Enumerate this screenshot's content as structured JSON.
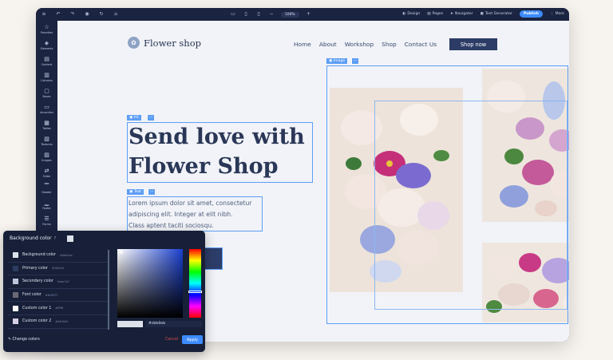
{
  "toolbar": {
    "zoom": "100%",
    "right_items": [
      "Design",
      "Pages",
      "Navigator",
      "Text Generator"
    ],
    "publish": "Publish",
    "more": "More"
  },
  "sidebar": {
    "items": [
      "Favorites",
      "Elements",
      "Content",
      "Columns",
      "Boxes",
      "Accordion",
      "Tables",
      "Textures",
      "Images",
      "Slider",
      "Header",
      "Footer",
      "Forms"
    ]
  },
  "site": {
    "logo_text": "Flower shop",
    "nav": [
      "Home",
      "About",
      "Workshop",
      "Shop",
      "Contact Us"
    ],
    "shop_button": "Shop now",
    "heading_tag": "H1",
    "heading_line1": "Send love with",
    "heading_line2": "Flower Shop",
    "text_tag": "Text",
    "para_line1": "Lorem ipsum dolor sit amet, consectetur",
    "para_line2": "adipiscing elit. Integer at elit nibh.",
    "para_line3": "Class aptent taciti sociosqu.",
    "image_tag": "Image"
  },
  "color_panel": {
    "title": "Background color",
    "colors": [
      {
        "label": "Background color",
        "hex": "#dde2ea",
        "swatch": "#dde2ea"
      },
      {
        "label": "Primary color",
        "hex": "#2b3c5e",
        "swatch": "#2b3c5e"
      },
      {
        "label": "Secondary color",
        "hex": "#aac7a7",
        "swatch": "#b9c7d8"
      },
      {
        "label": "Font color",
        "hex": "#6c6977",
        "swatch": "#6c6977"
      },
      {
        "label": "Custom color 1",
        "hex": "#ffffff",
        "swatch": "#ffffff"
      },
      {
        "label": "Custom color 2",
        "hex": "#d5d0e5",
        "swatch": "#d5d0e5"
      }
    ],
    "change_colors": "Change colors",
    "hex_value": "#dde0eb",
    "cancel": "Cancel",
    "apply": "Apply"
  }
}
